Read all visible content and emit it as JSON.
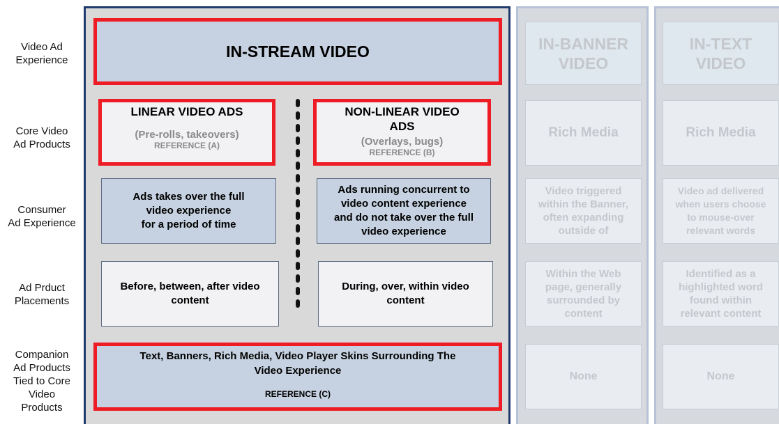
{
  "row_labels": {
    "video_ad_experience": [
      "Video Ad",
      "Experience"
    ],
    "core_products": [
      "Core Video",
      "Ad Products"
    ],
    "consumer_experience": [
      "Consumer",
      "Ad Experience"
    ],
    "placements": [
      "Ad Prduct",
      "Placements"
    ],
    "companion": [
      "Companion",
      "Ad Products",
      "Tied to Core",
      "Video",
      "Products"
    ]
  },
  "instream": {
    "title": "IN-STREAM VIDEO",
    "linear": {
      "title": "LINEAR VIDEO ADS",
      "subtitle": "(Pre-rolls, takeovers)",
      "reference": "REFERENCE (A)"
    },
    "nonlinear": {
      "title_1": "NON-LINEAR VIDEO",
      "title_2": "ADS",
      "subtitle": "(Overlays, bugs)",
      "reference": "REFERENCE (B)"
    },
    "linear_experience": [
      "Ads takes over the full",
      "video experience",
      "for a period of time"
    ],
    "nonlinear_experience": [
      "Ads running concurrent to",
      "video content experience",
      "and do not take over the full",
      "video experience"
    ],
    "linear_placement": [
      "Before, between, after video",
      "content"
    ],
    "nonlinear_placement": [
      "During, over, within video",
      "content"
    ],
    "companion": {
      "line_1": "Text, Banners, Rich Media, Video Player Skins Surrounding The",
      "line_2": "Video Experience",
      "reference": "REFERENCE (C)"
    }
  },
  "inbanner": {
    "title": [
      "IN-BANNER",
      "VIDEO"
    ],
    "product": "Rich Media",
    "experience": [
      "Video triggered",
      "within the Banner,",
      "often expanding",
      "outside of"
    ],
    "placement": [
      "Within the Web",
      "page, generally",
      "surrounded by",
      "content"
    ],
    "companion": "None"
  },
  "intext": {
    "title": [
      "IN-TEXT",
      "VIDEO"
    ],
    "product": "Rich Media",
    "experience": [
      "Video ad delivered",
      "when users choose",
      "to mouse-over",
      "relevant words"
    ],
    "placement": [
      "Identified as a",
      "highlighted word",
      "found within",
      "relevant content"
    ],
    "companion": "None"
  },
  "colors": {
    "frame": "#1f3a6e",
    "highlight": "#ee1c24",
    "box_blue": "#c6d2e1",
    "faded_frame": "#b7c2d8"
  }
}
